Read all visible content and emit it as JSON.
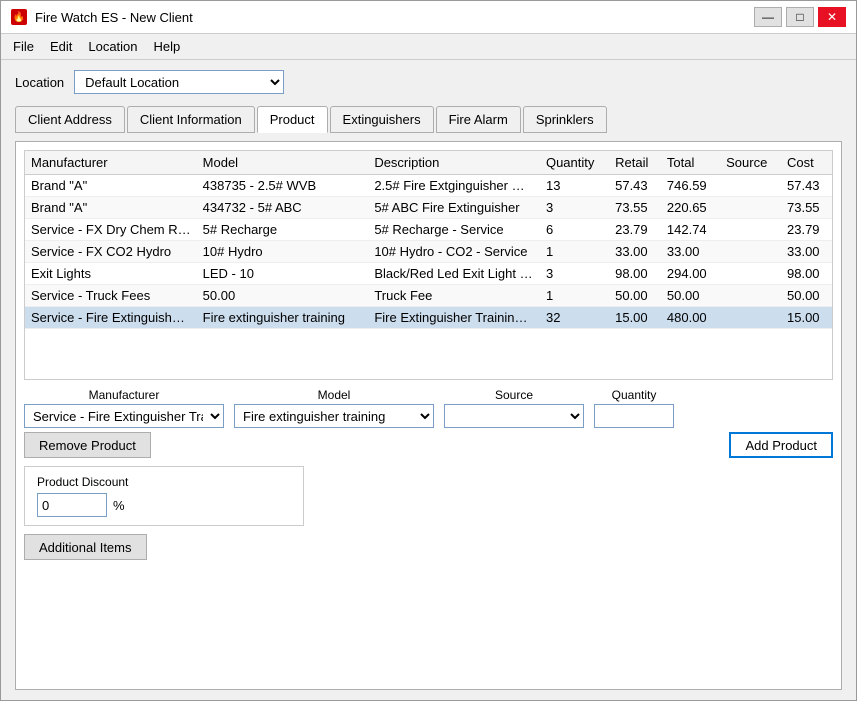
{
  "window": {
    "title": "Fire Watch ES - New Client",
    "icon": "🔥"
  },
  "title_controls": {
    "minimize": "—",
    "maximize": "□",
    "close": "✕"
  },
  "menu": {
    "items": [
      "File",
      "Edit",
      "Location",
      "Help"
    ]
  },
  "location": {
    "label": "Location",
    "value": "Default Location",
    "options": [
      "Default Location"
    ]
  },
  "tabs": [
    {
      "id": "client-address",
      "label": "Client Address",
      "active": false
    },
    {
      "id": "client-info",
      "label": "Client Information",
      "active": false
    },
    {
      "id": "product",
      "label": "Product",
      "active": true
    },
    {
      "id": "extinguishers",
      "label": "Extinguishers",
      "active": false
    },
    {
      "id": "fire-alarm",
      "label": "Fire Alarm",
      "active": false
    },
    {
      "id": "sprinklers",
      "label": "Sprinklers",
      "active": false
    }
  ],
  "table": {
    "columns": [
      "Manufacturer",
      "Model",
      "Description",
      "Quantity",
      "Retail",
      "Total",
      "Source",
      "Cost"
    ],
    "rows": [
      {
        "manufacturer": "Brand \"A\"",
        "model": "438735 - 2.5# WVB",
        "description": "2.5# Fire Extginguisher W...",
        "quantity": "13",
        "retail": "57.43",
        "total": "746.59",
        "source": "",
        "cost": "57.43"
      },
      {
        "manufacturer": "Brand \"A\"",
        "model": "434732 - 5# ABC",
        "description": "5# ABC Fire Extinguisher",
        "quantity": "3",
        "retail": "73.55",
        "total": "220.65",
        "source": "",
        "cost": "73.55"
      },
      {
        "manufacturer": "Service - FX Dry Chem Rec...",
        "model": "5# Recharge",
        "description": "5# Recharge  - Service",
        "quantity": "6",
        "retail": "23.79",
        "total": "142.74",
        "source": "",
        "cost": "23.79"
      },
      {
        "manufacturer": "Service - FX CO2 Hydro",
        "model": "10# Hydro",
        "description": "10# Hydro - CO2 - Service",
        "quantity": "1",
        "retail": "33.00",
        "total": "33.00",
        "source": "",
        "cost": "33.00"
      },
      {
        "manufacturer": "Exit Lights",
        "model": "LED - 10",
        "description": "Black/Red Led Exit Light C...",
        "quantity": "3",
        "retail": "98.00",
        "total": "294.00",
        "source": "",
        "cost": "98.00"
      },
      {
        "manufacturer": "Service - Truck Fees",
        "model": "50.00",
        "description": "Truck Fee",
        "quantity": "1",
        "retail": "50.00",
        "total": "50.00",
        "source": "",
        "cost": "50.00"
      },
      {
        "manufacturer": "Service - Fire Extinguisher ...",
        "model": "Fire extinguisher training",
        "description": "Fire Extinguisher Training ...",
        "quantity": "32",
        "retail": "15.00",
        "total": "480.00",
        "source": "",
        "cost": "15.00"
      }
    ]
  },
  "product_form": {
    "manufacturer_label": "Manufacturer",
    "model_label": "Model",
    "source_label": "Source",
    "quantity_label": "Quantity",
    "manufacturer_value": "Service - Fire Extinguisher Training",
    "model_value": "Fire extinguisher training",
    "source_value": "",
    "quantity_value": "",
    "manufacturer_options": [
      "Service - Fire Extinguisher Training"
    ],
    "model_options": [
      "Fire extinguisher training"
    ],
    "source_options": [
      ""
    ]
  },
  "buttons": {
    "remove_product": "Remove Product",
    "add_product": "Add Product",
    "additional_items": "Additional Items"
  },
  "discount": {
    "label": "Product Discount",
    "value": "0",
    "unit": "%"
  }
}
